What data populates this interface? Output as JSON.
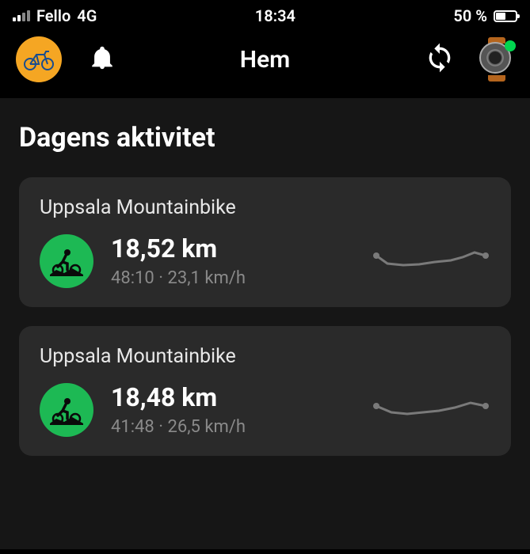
{
  "status_bar": {
    "carrier": "Fello",
    "network": "4G",
    "time": "18:34",
    "battery_percent": "50 %"
  },
  "nav": {
    "title": "Hem"
  },
  "section": {
    "title": "Dagens aktivitet"
  },
  "activities": [
    {
      "title": "Uppsala Mountainbike",
      "distance": "18,52 km",
      "duration": "48:10",
      "speed": "23,1 km/h"
    },
    {
      "title": "Uppsala Mountainbike",
      "distance": "18,48 km",
      "duration": "41:48",
      "speed": "26,5 km/h"
    }
  ]
}
